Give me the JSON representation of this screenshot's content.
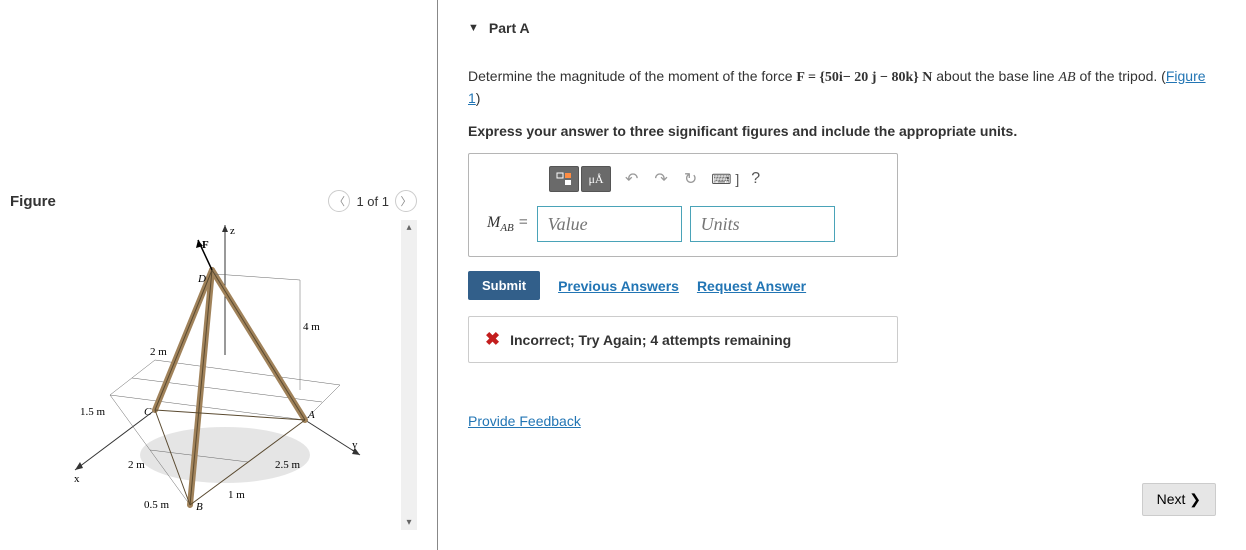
{
  "figure": {
    "title": "Figure",
    "pager": "1 of 1",
    "labels": {
      "z": "z",
      "x": "x",
      "y": "y",
      "F": "F",
      "D": "D",
      "C": "C",
      "A": "A",
      "B": "B",
      "d_4m": "4 m",
      "d_2m_top": "2 m",
      "d_15m": "1.5 m",
      "d_2m_bottom": "2 m",
      "d_25m": "2.5 m",
      "d_1m": "1 m",
      "d_05m": "0.5 m"
    }
  },
  "part": {
    "header": "Part A",
    "text_prefix": "Determine the magnitude of the moment of the force ",
    "force_expr": "F = {50i− 20 j − 80k} N",
    "text_mid": " about the base line ",
    "line_name": "AB",
    "text_suffix": " of the tripod. (",
    "figure_link": "Figure 1",
    "text_end": ")",
    "instruction": "Express your answer to three significant figures and include the appropriate units."
  },
  "answer": {
    "label": "M",
    "subscript": "AB",
    "equals": " =",
    "value_placeholder": "Value",
    "units_placeholder": "Units",
    "toolbar": {
      "templates": "⊞",
      "units_btn": "μÅ",
      "undo": "↶",
      "redo": "↷",
      "reset": "↻",
      "keyboard": "⌨ ]",
      "help": "?"
    }
  },
  "submit": {
    "button": "Submit",
    "prev_answers": "Previous Answers",
    "request_answer": "Request Answer"
  },
  "feedback": {
    "icon": "✖",
    "message": "Incorrect; Try Again; 4 attempts remaining"
  },
  "footer": {
    "provide_feedback": "Provide Feedback",
    "next": "Next ❯"
  }
}
